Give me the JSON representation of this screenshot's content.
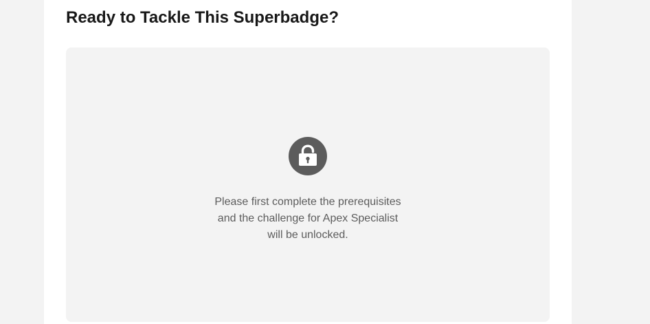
{
  "section": {
    "title": "Ready to Tackle This Superbadge?"
  },
  "locked_panel": {
    "icon": "unlocked-padlock-icon",
    "message_lines": [
      "Please first complete the prerequisites",
      "and the challenge for Apex Specialist",
      "will be unlocked."
    ]
  },
  "colors": {
    "page_background": "#f3f3f3",
    "card_background": "#ffffff",
    "panel_background": "#f3f3f3",
    "title_text": "#181818",
    "icon_circle": "#5c5c5c",
    "icon_glyph": "#ffffff",
    "message_text": "#5c5c5c"
  }
}
